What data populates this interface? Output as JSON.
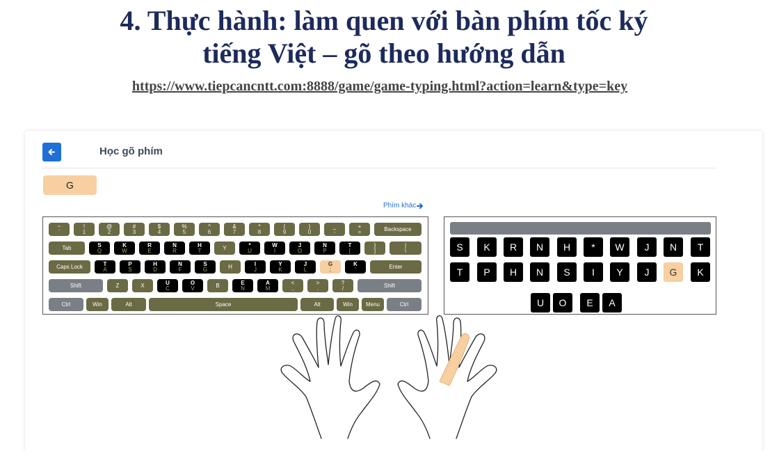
{
  "slide": {
    "title_line1": "4. Thực hành: làm quen với bàn phím tốc ký",
    "title_line2": "tiếng Việt – gõ theo hướng dẫn",
    "url": "https://www.tiepcancntt.com:8888/game/game-typing.html?action=learn&type=key"
  },
  "app": {
    "page_title": "Học gõ phím",
    "current_key": "G",
    "other_keys_label": "Phím khác",
    "back_icon": "arrow-left-icon",
    "other_keys_icon": "arrow-right-icon",
    "accent_color": "#1e6fd6",
    "highlight_color": "#f7cfa0"
  },
  "keyboard": {
    "keys": [
      {
        "top": "~",
        "bot": "`"
      },
      {
        "top": "!",
        "bot": "1"
      },
      {
        "top": "@",
        "bot": "2"
      },
      {
        "top": "#",
        "bot": "3"
      },
      {
        "top": "$",
        "bot": "4"
      },
      {
        "top": "%",
        "bot": "5"
      },
      {
        "top": "^",
        "bot": "6"
      },
      {
        "top": "&",
        "bot": "7"
      },
      {
        "top": "*",
        "bot": "8"
      },
      {
        "top": "(",
        "bot": "9"
      },
      {
        "top": ")",
        "bot": "0"
      },
      {
        "top": "_",
        "bot": "-"
      },
      {
        "top": "+",
        "bot": "="
      },
      {
        "top": "Backspace",
        "bot": ""
      },
      {
        "top": "Tab",
        "bot": ""
      },
      {
        "top": "S",
        "bot": "Q"
      },
      {
        "top": "K",
        "bot": "W"
      },
      {
        "top": "R",
        "bot": "E"
      },
      {
        "top": "N",
        "bot": "R"
      },
      {
        "top": "H",
        "bot": "T"
      },
      {
        "top": "Y",
        "bot": ""
      },
      {
        "top": "*",
        "bot": "U"
      },
      {
        "top": "W",
        "bot": "I"
      },
      {
        "top": "J",
        "bot": "O"
      },
      {
        "top": "N",
        "bot": "P"
      },
      {
        "top": "T",
        "bot": "["
      },
      {
        "top": "}",
        "bot": "]"
      },
      {
        "top": "|",
        "bot": "\\"
      },
      {
        "top": "Caps Lock",
        "bot": ""
      },
      {
        "top": "T",
        "bot": "A"
      },
      {
        "top": "P",
        "bot": "S"
      },
      {
        "top": "H",
        "bot": "D"
      },
      {
        "top": "N",
        "bot": "F"
      },
      {
        "top": "S",
        "bot": "G"
      },
      {
        "top": "H",
        "bot": ""
      },
      {
        "top": "I",
        "bot": "J"
      },
      {
        "top": "Y",
        "bot": "K"
      },
      {
        "top": "J",
        "bot": "L"
      },
      {
        "top": "G",
        "bot": ";"
      },
      {
        "top": "K",
        "bot": "'"
      },
      {
        "top": "Enter",
        "bot": ""
      },
      {
        "top": "Shift",
        "bot": ""
      },
      {
        "top": "Z",
        "bot": ""
      },
      {
        "top": "X",
        "bot": ""
      },
      {
        "top": "U",
        "bot": "C"
      },
      {
        "top": "O",
        "bot": "V"
      },
      {
        "top": "B",
        "bot": ""
      },
      {
        "top": "E",
        "bot": "N"
      },
      {
        "top": "A",
        "bot": "M"
      },
      {
        "top": "<",
        "bot": ","
      },
      {
        "top": ">",
        "bot": "."
      },
      {
        "top": "?",
        "bot": "/"
      },
      {
        "top": "Shift",
        "bot": ""
      },
      {
        "top": "Ctrl",
        "bot": ""
      },
      {
        "top": "Win",
        "bot": ""
      },
      {
        "top": "Alt",
        "bot": ""
      },
      {
        "top": "Space",
        "bot": ""
      },
      {
        "top": "Alt",
        "bot": ""
      },
      {
        "top": "Win",
        "bot": ""
      },
      {
        "top": "Menu",
        "bot": ""
      },
      {
        "top": "Ctrl",
        "bot": ""
      }
    ]
  },
  "stenotype": {
    "keys": [
      "S",
      "K",
      "R",
      "N",
      "H",
      "*",
      "W",
      "J",
      "N",
      "T",
      "T",
      "P",
      "H",
      "N",
      "S",
      "I",
      "Y",
      "J",
      "G",
      "K",
      "U",
      "O",
      "E",
      "A"
    ]
  }
}
